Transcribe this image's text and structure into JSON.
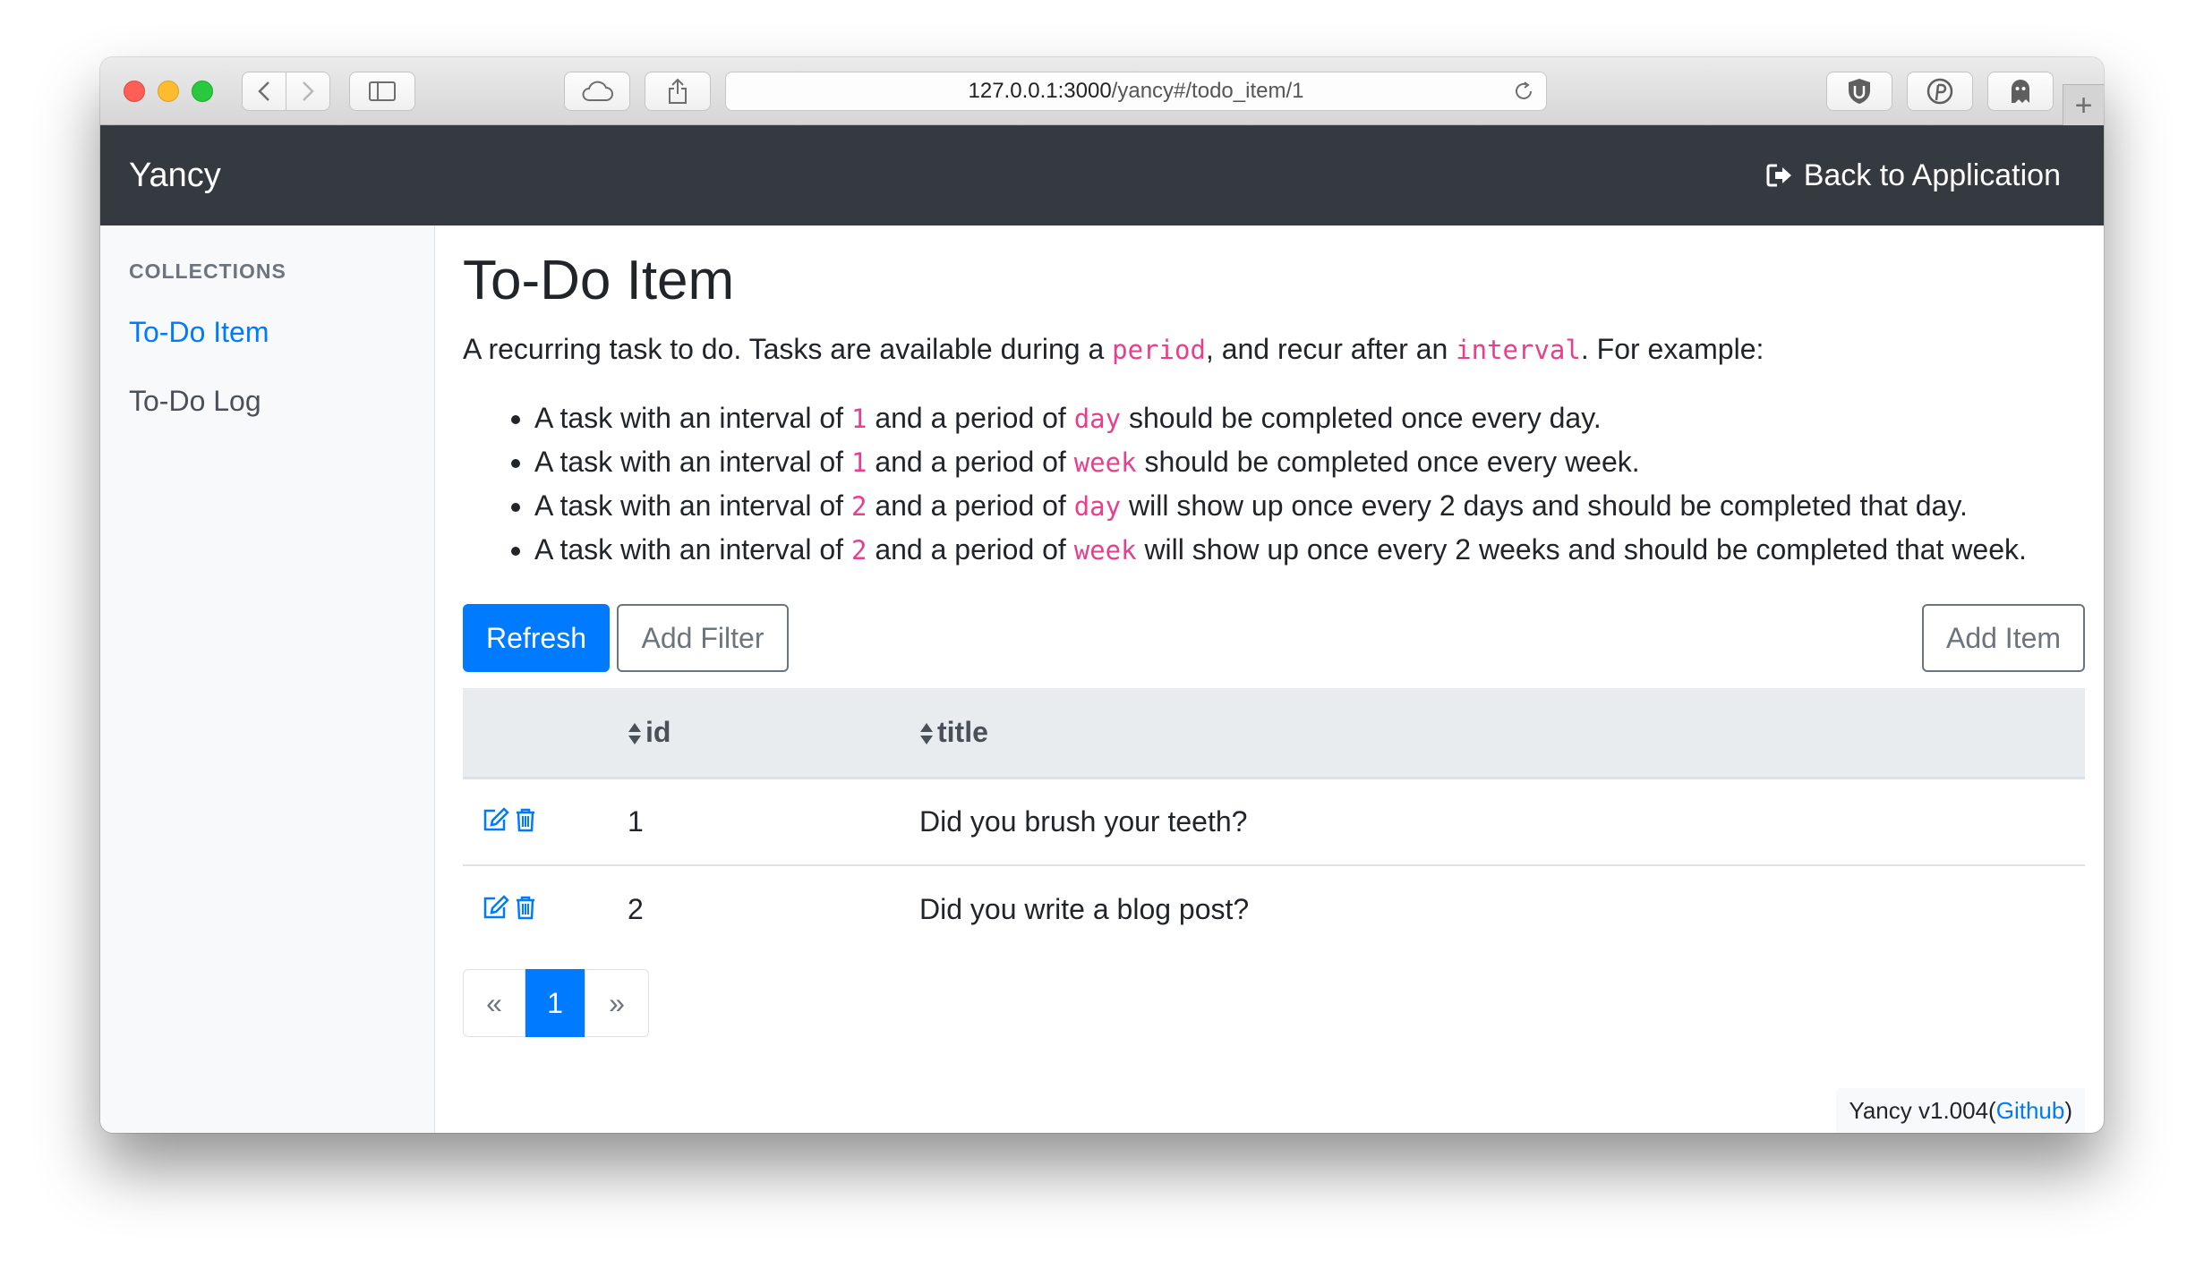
{
  "browser": {
    "url_host": "127.0.0.1:3000",
    "url_path": "/yancy#/todo_item/1"
  },
  "navbar": {
    "brand": "Yancy",
    "back_link": "Back to Application"
  },
  "sidebar": {
    "heading": "COLLECTIONS",
    "items": [
      {
        "label": "To-Do Item",
        "active": true
      },
      {
        "label": "To-Do Log",
        "active": false
      }
    ]
  },
  "main": {
    "title": "To-Do Item",
    "description": {
      "part1": "A recurring task to do. Tasks are available during a ",
      "code1": "period",
      "part2": ", and recur after an ",
      "code2": "interval",
      "part3": ". For example:"
    },
    "examples": [
      {
        "a": "A task with an interval of ",
        "interval": "1",
        "b": " and a period of ",
        "period": "day",
        "c": " should be completed once every day."
      },
      {
        "a": "A task with an interval of ",
        "interval": "1",
        "b": " and a period of ",
        "period": "week",
        "c": " should be completed once every week."
      },
      {
        "a": "A task with an interval of ",
        "interval": "2",
        "b": " and a period of ",
        "period": "day",
        "c": " will show up once every 2 days and should be completed that day."
      },
      {
        "a": "A task with an interval of ",
        "interval": "2",
        "b": " and a period of ",
        "period": "week",
        "c": " will show up once every 2 weeks and should be completed that week."
      }
    ],
    "toolbar": {
      "refresh": "Refresh",
      "add_filter": "Add Filter",
      "add_item": "Add Item"
    },
    "table": {
      "columns": [
        "id",
        "title"
      ],
      "rows": [
        {
          "id": "1",
          "title": "Did you brush your teeth?"
        },
        {
          "id": "2",
          "title": "Did you write a blog post?"
        }
      ]
    },
    "pagination": {
      "prev": "«",
      "current": "1",
      "next": "»"
    }
  },
  "footer": {
    "version": "Yancy v1.004",
    "open_paren": " (",
    "link": "Github",
    "close_paren": ")"
  },
  "colors": {
    "primary": "#007bff",
    "navbar": "#343a40",
    "code": "#e83e8c"
  }
}
